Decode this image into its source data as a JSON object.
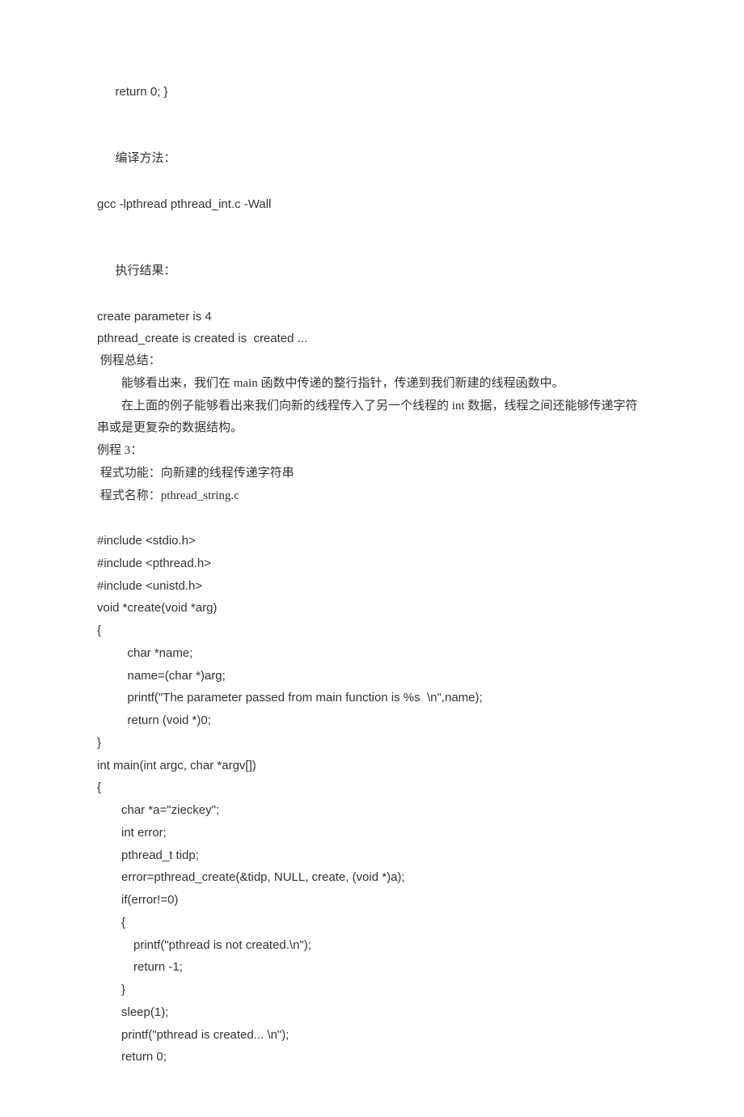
{
  "lines": {
    "l1": "return 0; }",
    "l2": "编译方法：",
    "l3": "gcc -lpthread pthread_int.c -Wall",
    "l4": "执行结果：",
    "l5": "create parameter is 4",
    "l6": "pthread_create is created is  created ...",
    "l7": " 例程总结：",
    "l8": "能够看出来，我们在 main 函数中传递的整行指针，传递到我们新建的线程函数中。",
    "l9": "在上面的例子能够看出来我们向新的线程传入了另一个线程的 int 数据，线程之间还能够传递字符串或是更复杂的数据结构。",
    "l10": "例程 3：",
    "l11": " 程式功能：向新建的线程传递字符串",
    "l12": " 程式名称：pthread_string.c",
    "code": {
      "c1": "#include <stdio.h>",
      "c2": "#include <pthread.h>",
      "c3": "#include <unistd.h>",
      "c4": "void *create(void *arg)",
      "c5": "{",
      "c6": "char *name;",
      "c7": "name=(char *)arg;",
      "c8": "printf(\"The parameter passed from main function is %s  \\n\",name);",
      "c9": "return (void *)0;",
      "c10": "}",
      "c11": "int main(int argc, char *argv[])",
      "c12": "{",
      "c13": "char *a=\"zieckey\";",
      "c14": "int error;",
      "c15": "pthread_t tidp;",
      "c16": "error=pthread_create(&tidp, NULL, create, (void *)a);",
      "c17": "if(error!=0)",
      "c18": "{",
      "c19": "printf(\"pthread is not created.\\n\");",
      "c20": "return -1;",
      "c21": "}",
      "c22": "sleep(1);",
      "c23": "printf(\"pthread is created... \\n\");",
      "c24": "return 0;"
    }
  }
}
